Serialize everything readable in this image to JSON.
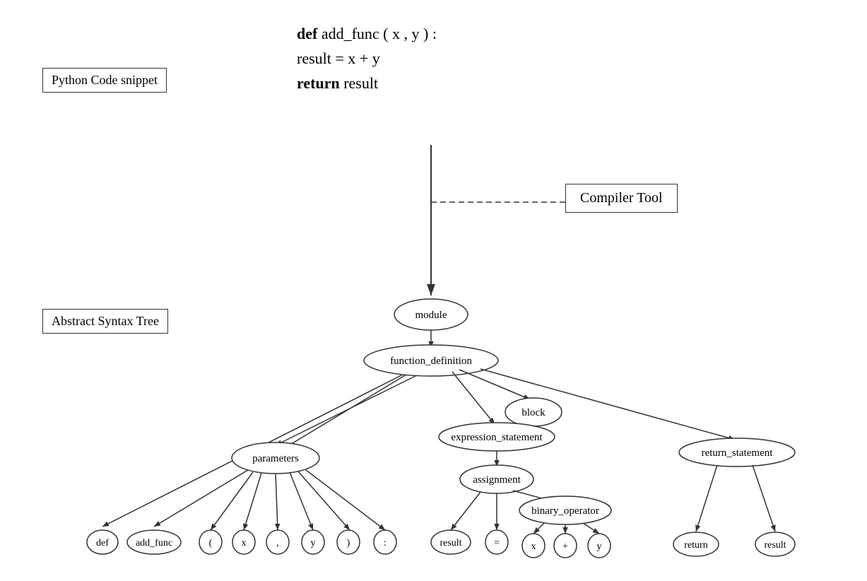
{
  "labels": {
    "python_code": "Python Code snippet",
    "ast": "Abstract Syntax Tree",
    "compiler_tool": "Compiler Tool"
  },
  "code": {
    "line1_kw": "def",
    "line1_rest": "  add_func ( x , y ) :",
    "line2": "  result  =  x  +  y",
    "line3_kw": "return",
    "line3_rest": "   result"
  },
  "nodes": {
    "module": "module",
    "function_definition": "function_definition",
    "block": "block",
    "parameters": "parameters",
    "expression_statement": "expression_statement",
    "return_statement": "return_statement",
    "assignment": "assignment",
    "binary_operator": "binary_operator",
    "def": "def",
    "add_func": "add_func",
    "lparen": "(",
    "x1": "x",
    "comma": ",",
    "y1": "y",
    "rparen": ")",
    "colon": ":",
    "result1": "result",
    "eq": "=",
    "x2": "x",
    "plus": "+",
    "y2": "y",
    "return_kw": "return",
    "result2": "result"
  }
}
